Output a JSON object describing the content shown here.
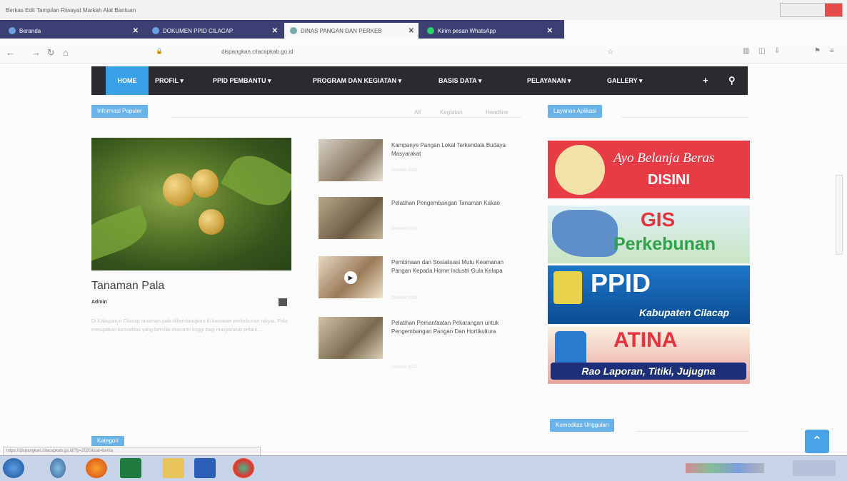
{
  "browser": {
    "menu": "Berkas  Edit  Tampilan  Riwayat  Markah  Alat  Bantuan",
    "tabs": [
      {
        "label": "Beranda"
      },
      {
        "label": "DOKUMEN PPID CILACAP"
      },
      {
        "label": "DINAS PANGAN DAN PERKEB"
      },
      {
        "label": "Kirim pesan WhatsApp"
      }
    ],
    "url": "dispangkan.cilacapkab.go.id",
    "status_url": "https://dispangkan.cilacapkab.go.id/?p=2020&cat=berita"
  },
  "nav": {
    "home": "HOME",
    "items": [
      "PROFIL ▾",
      "PPID PEMBANTU ▾",
      "PROGRAM DAN KEGIATAN ▾",
      "BASIS DATA ▾",
      "PELAYANAN ▾",
      "GALLERY ▾"
    ],
    "more": "+"
  },
  "sections": {
    "informasi": "Informasi Populer",
    "filters": [
      "All",
      "Kegiatan",
      "Headline"
    ],
    "layanan": "Layanan Aplikasi",
    "bottom_left": "Kategori",
    "unggulan": "Komoditas Unggulan"
  },
  "main_post": {
    "title": "Tanaman Pala",
    "author": "Admin",
    "excerpt": "Di Kabupaten Cilacap tanaman pala dikembangkan di kawasan perkebunan rakyat. Pala merupakan komoditas yang bernilai ekonomi tinggi bagi masyarakat petani ..."
  },
  "news": [
    {
      "title": "Kampanye Pangan Lokal Terkendala Budaya Masyarakat",
      "date": "Oktober 2020"
    },
    {
      "title": "Pelatihan Pengembangan Tanaman Kakao",
      "date": "Oktober 2020"
    },
    {
      "title": "Pembinaan dan Sosialisasi Mutu Keamanan Pangan Kepada Home Industri Gula Kelapa",
      "date": "Oktober 2020"
    },
    {
      "title": "Pelatihan Pemanfaatan Pekarangan untuk Pengembangan Pangan Dan Hortikultura",
      "date": "Oktober 2020"
    }
  ],
  "banners": {
    "beras_top": "Ayo Belanja Beras",
    "beras_bottom": "DISINI",
    "gis_top": "GIS",
    "gis_bottom": "Perkebunan",
    "ppid_top": "PPID",
    "ppid_bottom": "Kabupaten Cilacap",
    "atina_top": "ATINA",
    "atina_bottom": "Rao Laporan, Titiki, Jujugna"
  },
  "colors": {
    "accent": "#3aa0e8",
    "nav_bg": "#2b2b2f",
    "tabstrip": "#3b3f73"
  }
}
